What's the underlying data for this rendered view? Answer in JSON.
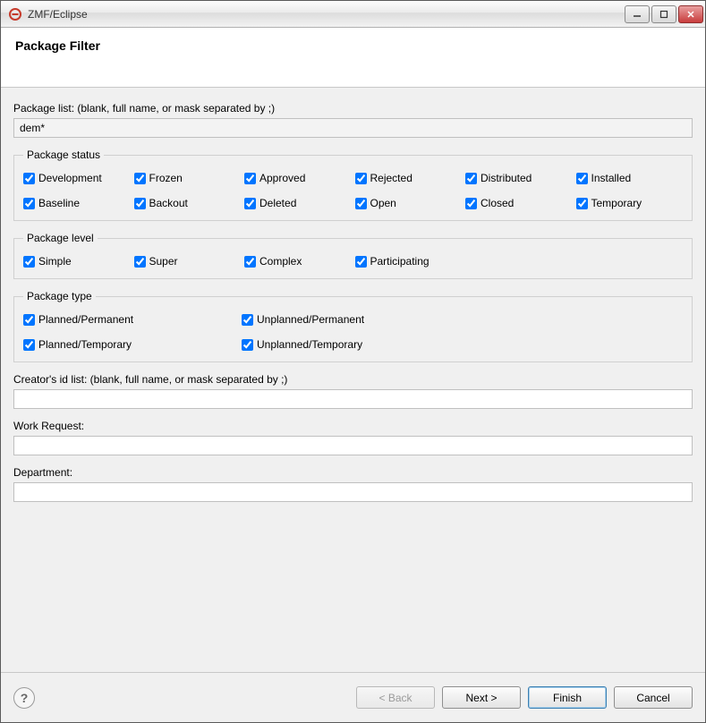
{
  "titlebar": {
    "title": "ZMF/Eclipse"
  },
  "banner": {
    "heading": "Package Filter"
  },
  "packageList": {
    "label": "Package list:  (blank, full name, or mask separated by ;)",
    "value": "dem*"
  },
  "statusGroup": {
    "legend": "Package status",
    "items": [
      {
        "name": "status-development",
        "label": "Development",
        "checked": true
      },
      {
        "name": "status-frozen",
        "label": "Frozen",
        "checked": true
      },
      {
        "name": "status-approved",
        "label": "Approved",
        "checked": true
      },
      {
        "name": "status-rejected",
        "label": "Rejected",
        "checked": true
      },
      {
        "name": "status-distributed",
        "label": "Distributed",
        "checked": true
      },
      {
        "name": "status-installed",
        "label": "Installed",
        "checked": true
      },
      {
        "name": "status-baseline",
        "label": "Baseline",
        "checked": true
      },
      {
        "name": "status-backout",
        "label": "Backout",
        "checked": true
      },
      {
        "name": "status-deleted",
        "label": "Deleted",
        "checked": true
      },
      {
        "name": "status-open",
        "label": "Open",
        "checked": true
      },
      {
        "name": "status-closed",
        "label": "Closed",
        "checked": true
      },
      {
        "name": "status-temporary",
        "label": "Temporary",
        "checked": true
      }
    ]
  },
  "levelGroup": {
    "legend": "Package level",
    "items": [
      {
        "name": "level-simple",
        "label": "Simple",
        "checked": true
      },
      {
        "name": "level-super",
        "label": "Super",
        "checked": true
      },
      {
        "name": "level-complex",
        "label": "Complex",
        "checked": true
      },
      {
        "name": "level-participating",
        "label": "Participating",
        "checked": true
      }
    ]
  },
  "typeGroup": {
    "legend": "Package type",
    "items": [
      {
        "name": "type-planned-permanent",
        "label": "Planned/Permanent",
        "checked": true
      },
      {
        "name": "type-unplanned-permanent",
        "label": "Unplanned/Permanent",
        "checked": true
      },
      {
        "name": "type-planned-temporary",
        "label": "Planned/Temporary",
        "checked": true
      },
      {
        "name": "type-unplanned-temporary",
        "label": "Unplanned/Temporary",
        "checked": true
      }
    ]
  },
  "creatorId": {
    "label": "Creator's id list:  (blank, full name, or mask separated by ;)",
    "value": ""
  },
  "workRequest": {
    "label": "Work Request:",
    "value": ""
  },
  "department": {
    "label": "Department:",
    "value": ""
  },
  "buttons": {
    "help": "?",
    "back": "< Back",
    "next": "Next >",
    "finish": "Finish",
    "cancel": "Cancel"
  }
}
